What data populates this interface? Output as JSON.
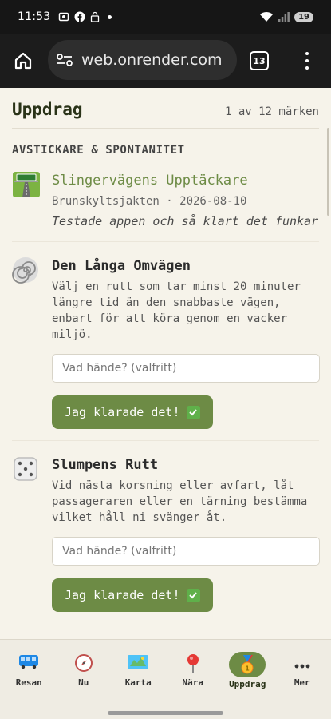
{
  "status_bar": {
    "time": "11:53",
    "battery": "19"
  },
  "browser": {
    "url": "web.onrender.com",
    "tab_count": "13"
  },
  "page": {
    "title": "Uppdrag",
    "count": "1 av 12 märken",
    "section": "AVSTICKARE & SPONTANITET"
  },
  "missions": [
    {
      "title": "Slingervägens Upptäckare",
      "meta": "Brunskyltsjakten · 2026-08-10",
      "note": "Testade appen och så klart det funkar",
      "icon": "highway-icon"
    },
    {
      "title": "Den Långa Omvägen",
      "description": "Välj en rutt som tar minst 20 minuter längre tid än den snabbaste vägen, enbart för att köra genom en vacker miljö.",
      "input_placeholder": "Vad hände? (valfritt)",
      "button_label": "Jag klarade det!",
      "icon": "spiral-icon"
    },
    {
      "title": "Slumpens Rutt",
      "description": "Vid nästa korsning eller avfart, låt passageraren eller en tärning bestämma vilket håll ni svänger åt.",
      "input_placeholder": "Vad hände? (valfritt)",
      "button_label": "Jag klarade det!",
      "icon": "dice-icon"
    }
  ],
  "nav": [
    {
      "label": "Resan",
      "icon": "bus-icon"
    },
    {
      "label": "Nu",
      "icon": "compass-icon"
    },
    {
      "label": "Karta",
      "icon": "map-icon"
    },
    {
      "label": "Nära",
      "icon": "pin-icon"
    },
    {
      "label": "Uppdrag",
      "icon": "medal-icon",
      "active": true
    },
    {
      "label": "Mer",
      "icon": "more-icon"
    }
  ],
  "colors": {
    "accent": "#6d8b45",
    "background": "#f6f3ea",
    "title": "#2a3318"
  }
}
